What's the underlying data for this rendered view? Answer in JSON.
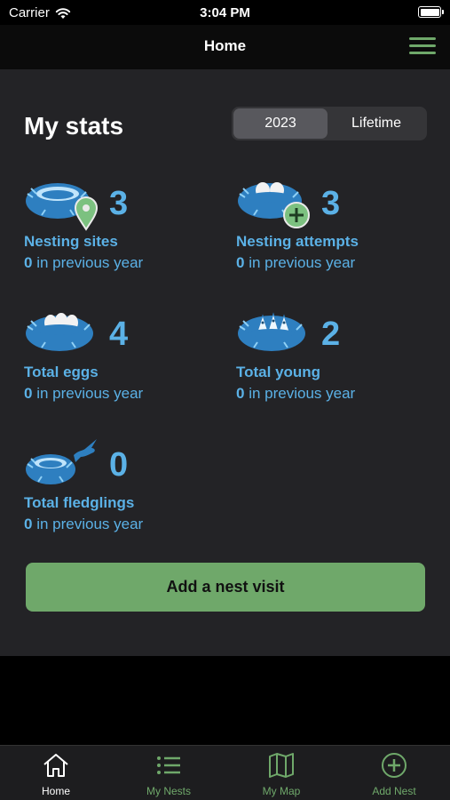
{
  "status_bar": {
    "carrier": "Carrier",
    "time": "3:04 PM"
  },
  "nav": {
    "title": "Home"
  },
  "stats": {
    "title": "My stats",
    "segments": [
      {
        "label": "2023",
        "selected": true
      },
      {
        "label": "Lifetime",
        "selected": false
      }
    ],
    "items": [
      {
        "icon": "nest-location-icon",
        "value": "3",
        "label": "Nesting sites",
        "prev_count": "0",
        "prev_text": " in previous year"
      },
      {
        "icon": "nest-attempt-add-icon",
        "value": "3",
        "label": "Nesting attempts",
        "prev_count": "0",
        "prev_text": " in previous year"
      },
      {
        "icon": "nest-eggs-icon",
        "value": "4",
        "label": "Total eggs",
        "prev_count": "0",
        "prev_text": " in previous year"
      },
      {
        "icon": "nest-young-icon",
        "value": "2",
        "label": "Total young",
        "prev_count": "0",
        "prev_text": " in previous year"
      },
      {
        "icon": "nest-fledgling-icon",
        "value": "0",
        "label": "Total fledglings",
        "prev_count": "0",
        "prev_text": " in previous year"
      }
    ]
  },
  "actions": {
    "add_visit": "Add a nest visit"
  },
  "tabs": [
    {
      "label": "Home",
      "icon": "house-icon",
      "active": true
    },
    {
      "label": "My Nests",
      "icon": "list-icon",
      "active": false
    },
    {
      "label": "My Map",
      "icon": "map-icon",
      "active": false
    },
    {
      "label": "Add Nest",
      "icon": "add-circle-icon",
      "active": false
    }
  ],
  "colors": {
    "accent_green": "#6fa86a",
    "stat_blue": "#5bb1e6",
    "background": "#232326"
  }
}
